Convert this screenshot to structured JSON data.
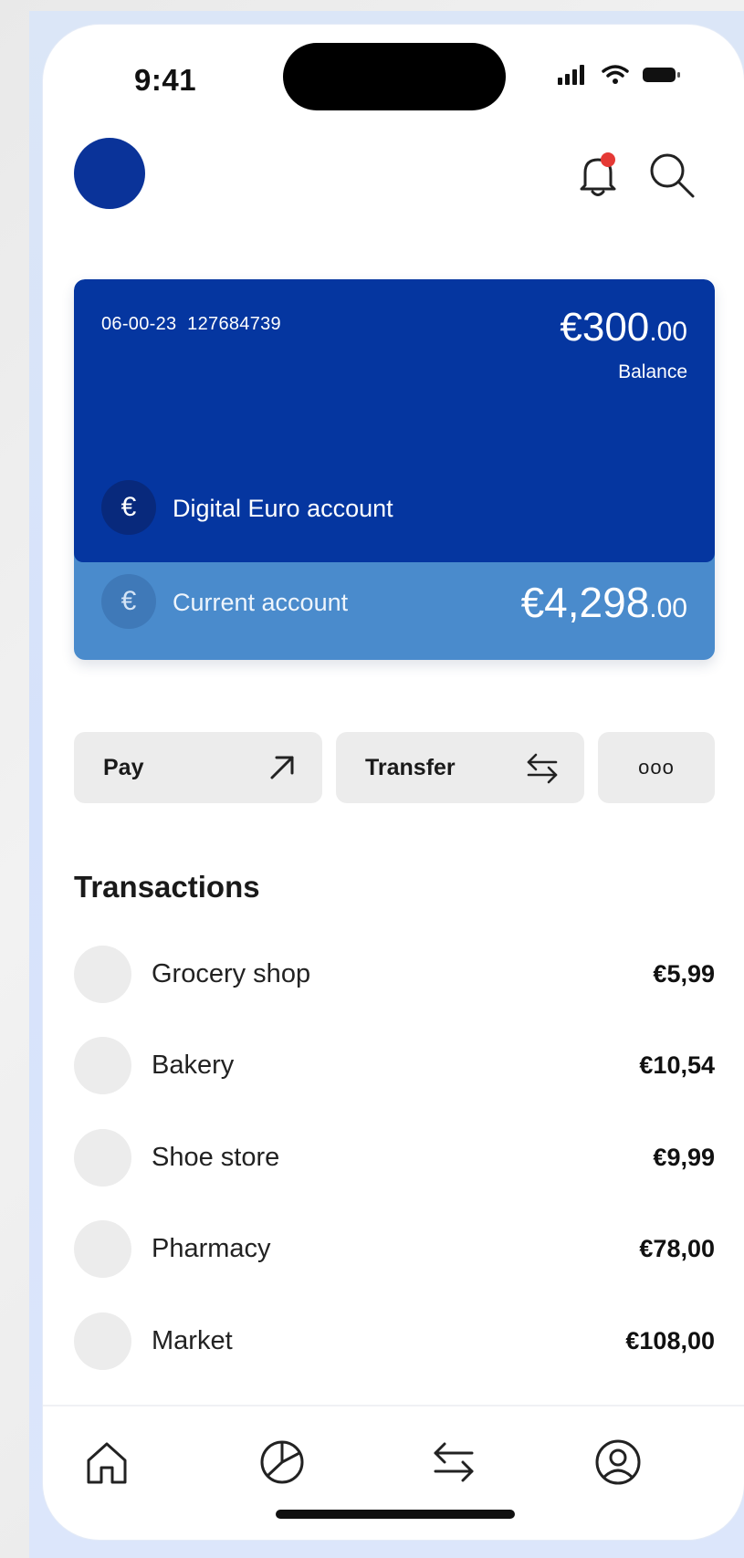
{
  "status_bar": {
    "time": "9:41"
  },
  "header": {
    "avatar_color": "#0a3399",
    "notification_icon": "bell-icon",
    "notification_dot_color": "#e53935",
    "search_icon": "search-icon"
  },
  "digital_account": {
    "account_number": "06-00-23  127684739",
    "balance_main": "€300",
    "balance_cents": ".00",
    "balance_label": "Balance",
    "badge_symbol": "€",
    "name": "Digital Euro account",
    "color": "#0536a0"
  },
  "current_account": {
    "badge_symbol": "€",
    "name": "Current account",
    "balance_main": "€4,298",
    "balance_cents": ".00",
    "color": "#4a8bcc"
  },
  "actions": {
    "pay_label": "Pay",
    "pay_icon": "arrow-up-right-icon",
    "transfer_label": "Transfer",
    "transfer_icon": "swap-arrows-icon",
    "more_label": "ooo"
  },
  "transactions": {
    "title": "Transactions",
    "items": [
      {
        "name": "Grocery shop",
        "amount": "€5,99"
      },
      {
        "name": "Bakery",
        "amount": "€10,54"
      },
      {
        "name": "Shoe store",
        "amount": "€9,99"
      },
      {
        "name": "Pharmacy",
        "amount": "€78,00"
      },
      {
        "name": "Market",
        "amount": "€108,00"
      }
    ]
  },
  "bottom_nav": {
    "items": [
      "home-icon",
      "pie-chart-icon",
      "swap-arrows-icon",
      "profile-icon"
    ]
  }
}
